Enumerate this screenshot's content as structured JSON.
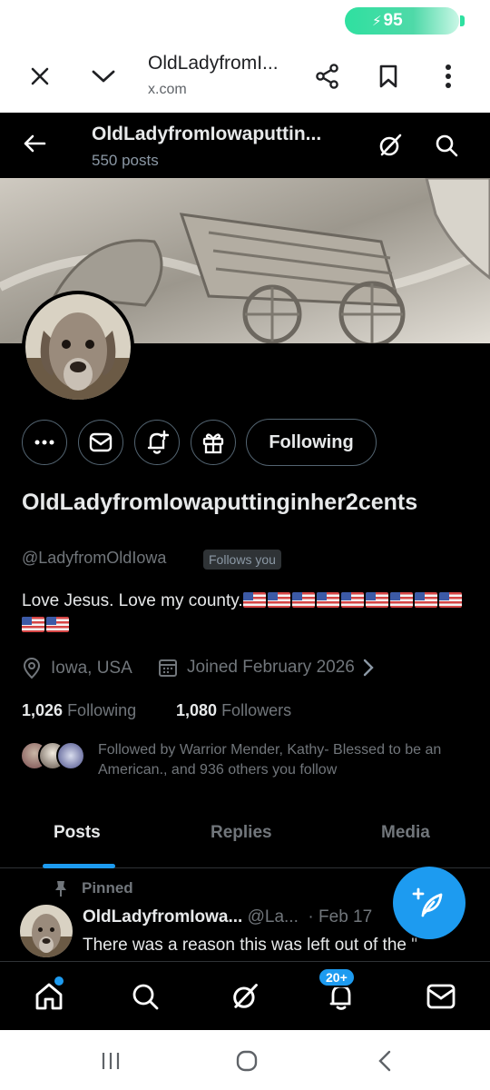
{
  "status": {
    "battery_label": "95"
  },
  "browser": {
    "tab_title": "OldLadyfromI...",
    "tab_url": "x.com"
  },
  "profile_header": {
    "title": "OldLadyfromIowaputtin...",
    "posts_count": "550 posts"
  },
  "profile": {
    "following_button": "Following",
    "display_name": "OldLadyfromIowaputtinginher2cents",
    "handle": "@LadyfromOldIowa",
    "follows_you": "Follows you",
    "bio_text": "Love Jesus. Love my county.",
    "flag_count": 11,
    "location": "Iowa, USA",
    "joined": "Joined February 2026",
    "following_count": "1,026",
    "following_label": "Following",
    "followers_count": "1,080",
    "followers_label": "Followers",
    "followed_by": "Followed by Warrior Mender, Kathy- Blessed to be an American., and 936 others you follow"
  },
  "tabs": [
    {
      "label": "Posts",
      "active": true
    },
    {
      "label": "Replies",
      "active": false
    },
    {
      "label": "Media",
      "active": false
    }
  ],
  "pinned_post": {
    "pinned_label": "Pinned",
    "author": "OldLadyfromIowa...",
    "handle": "@La...",
    "date": "· Feb 17",
    "text": "There was a reason this was left out of the \""
  },
  "bottom_nav": {
    "notifications_badge": "20+",
    "items": [
      "home-icon",
      "search-icon",
      "grok-icon",
      "notifications-icon",
      "messages-icon"
    ]
  },
  "colors": {
    "accent": "#1d9bf0",
    "background": "#000000",
    "text_primary": "#e7e9ea",
    "text_secondary": "#71767b"
  }
}
